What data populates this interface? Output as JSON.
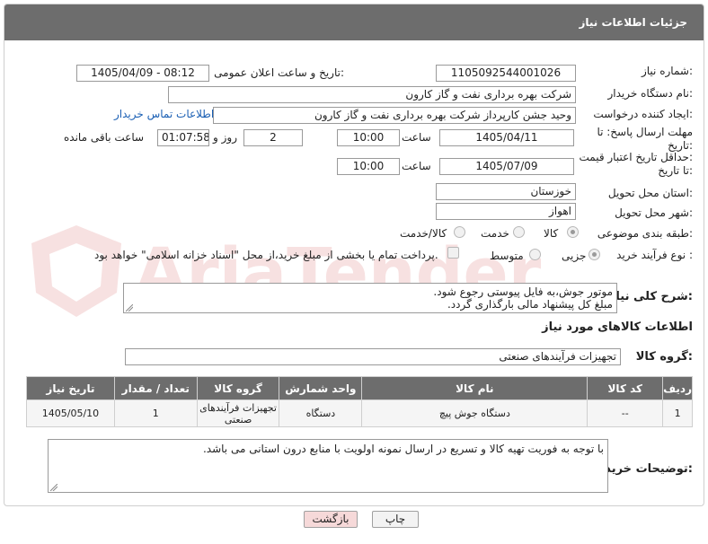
{
  "header": {
    "title": "جزئیات اطلاعات نیاز"
  },
  "need_number": {
    "label": "شماره نیاز:",
    "value": "1105092544001026"
  },
  "announce": {
    "label": "تاریخ و ساعت اعلان عمومی:",
    "value": "1405/04/09 - 08:12"
  },
  "buyer_org": {
    "label": "نام دستگاه خریدار:",
    "value": "شرکت بهره برداری نفت و گاز کارون"
  },
  "requester": {
    "label": "ایجاد کننده درخواست:",
    "value": "وحید جشن کارپرداز شرکت بهره برداری نفت و گاز کارون",
    "contact_link": "اطلاعات تماس خریدار"
  },
  "reply_deadline": {
    "label_line1": "مهلت ارسال پاسخ: تا",
    "label_line2": "تاریخ:",
    "date": "1405/04/11",
    "time_label": "ساعت",
    "time": "10:00",
    "days": "2",
    "days_label": "روز و",
    "remaining": "01:07:58",
    "remaining_label": "ساعت باقی مانده"
  },
  "price_validity": {
    "label_line1": "حداقل تاریخ اعتبار قیمت:",
    "label_line2": "تا تاریخ:",
    "date": "1405/07/09",
    "time_label": "ساعت",
    "time": "10:00"
  },
  "province": {
    "label": "استان محل تحویل:",
    "value": "خوزستان"
  },
  "city": {
    "label": "شهر محل تحویل:",
    "value": "اهواز"
  },
  "category": {
    "label": "طبقه بندی موضوعی:",
    "options": [
      "کالا",
      "خدمت",
      "کالا/خدمت"
    ],
    "selected": "کالا"
  },
  "process": {
    "label": "نوع فرآیند خرید :",
    "options": [
      "جزیی",
      "متوسط"
    ],
    "selected": "جزیی",
    "payment_note": "پرداخت تمام یا بخشی از مبلغ خرید،از محل \"اسناد خزانه اسلامی\" خواهد بود."
  },
  "description": {
    "label": "شرح کلی نیاز:",
    "line1": "موتور جوش،به فایل پیوستی رجوع شود.",
    "line2": "مبلغ کل پیشنهاد مالی بارگذاری گردد."
  },
  "goods_info": {
    "title": "اطلاعات کالاهای مورد نیاز"
  },
  "goods_group": {
    "label": "گروه کالا:",
    "value": "تجهیزات فرآیندهای صنعتی"
  },
  "table": {
    "headers": [
      "ردیف",
      "کد کالا",
      "نام کالا",
      "واحد شمارش",
      "گروه کالا",
      "تعداد / مقدار",
      "تاریخ نیاز"
    ],
    "rows": [
      [
        "1",
        "--",
        "دستگاه جوش پیچ",
        "دستگاه",
        "تجهیزات فرآیندهای صنعتی",
        "1",
        "1405/05/10"
      ]
    ]
  },
  "buyer_notes": {
    "label": "توضیحات خریدار:",
    "value": "با توجه به فوریت تهیه کالا و تسریع در ارسال نمونه اولویت با منابع درون استانی می باشد."
  },
  "buttons": {
    "print": "چاپ",
    "back": "بازگشت"
  },
  "watermark": {
    "text": "AriaTender.net"
  },
  "colors": {
    "header_bg": "#6d6d6d",
    "link": "#1a5fb4",
    "back_button": "#f6d9d9"
  }
}
